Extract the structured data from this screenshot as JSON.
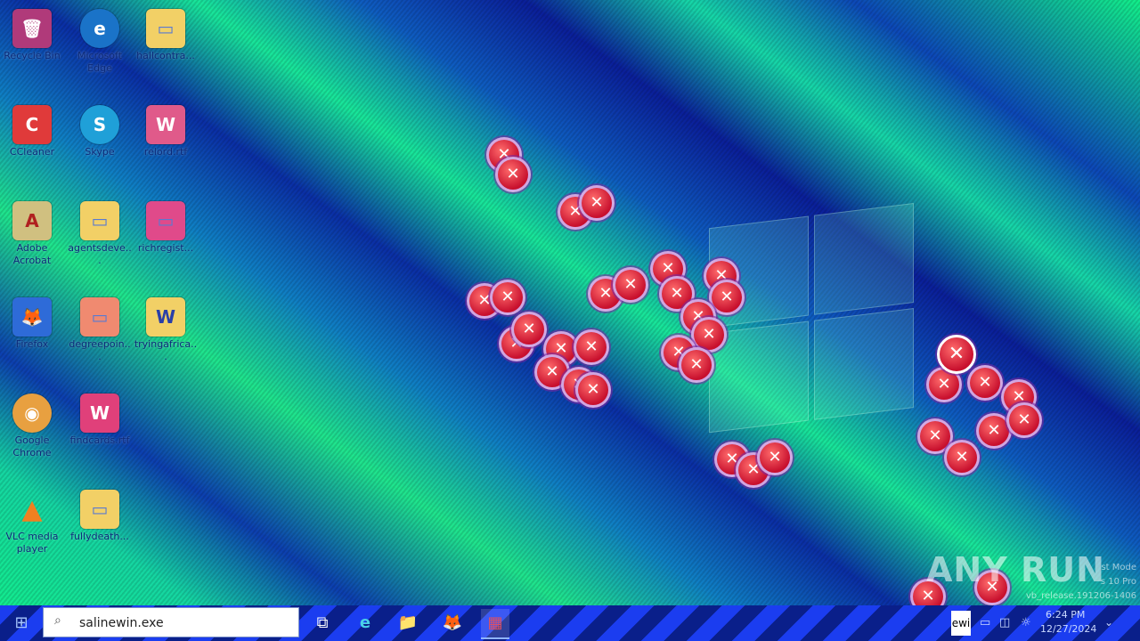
{
  "desktop": {
    "icons": [
      {
        "label": "Recycle Bin",
        "glyph": "🗑",
        "color": "#b03a7a"
      },
      {
        "label": "Microsoft Edge",
        "glyph": "e",
        "color": "#1a73c8"
      },
      {
        "label": "hallcontra...",
        "glyph": "▭",
        "color": "#f2d066"
      },
      {
        "label": "CCleaner",
        "glyph": "C",
        "color": "#e03a3a"
      },
      {
        "label": "Skype",
        "glyph": "S",
        "color": "#1fa0d8"
      },
      {
        "label": "relord.rtf",
        "glyph": "W",
        "color": "#e05a8a"
      },
      {
        "label": "Adobe Acrobat",
        "glyph": "A",
        "color": "#d0c080"
      },
      {
        "label": "agentsdeve...",
        "glyph": "▭",
        "color": "#f2d066"
      },
      {
        "label": "richregist...",
        "glyph": "▭",
        "color": "#e04a8a"
      },
      {
        "label": "Firefox",
        "glyph": "🦊",
        "color": "#2e6bd8"
      },
      {
        "label": "degreepoin...",
        "glyph": "▭",
        "color": "#f08a70"
      },
      {
        "label": "tryingafrica...",
        "glyph": "W",
        "color": "#f2d066"
      },
      {
        "label": "Google Chrome",
        "glyph": "◉",
        "color": "#e8a040"
      },
      {
        "label": "findcards.rtf",
        "glyph": "W",
        "color": "#e0407a"
      },
      {
        "label": "VLC media player",
        "glyph": "▲",
        "color": "#f08020"
      },
      {
        "label": "fullydeath...",
        "glyph": "▭",
        "color": "#f2d066"
      }
    ]
  },
  "error_icon_glyph": "✕",
  "taskbar": {
    "start_glyph": "⊞",
    "search_value": "salinewin.exe",
    "task_view_glyph": "⧉",
    "apps": [
      {
        "name": "edge",
        "glyph": "e"
      },
      {
        "name": "file-explorer",
        "glyph": "📁"
      },
      {
        "name": "firefox",
        "glyph": "🦊"
      },
      {
        "name": "winrar",
        "glyph": "▦"
      }
    ],
    "tray_label": "ewi",
    "time": "6:24 PM",
    "date": "12/27/2024"
  },
  "watermark": {
    "text": "ANY RUN",
    "mode_line1": "st Mode",
    "mode_line2": "s 10 Pro",
    "build_line": "vb_release.191206-1406"
  }
}
